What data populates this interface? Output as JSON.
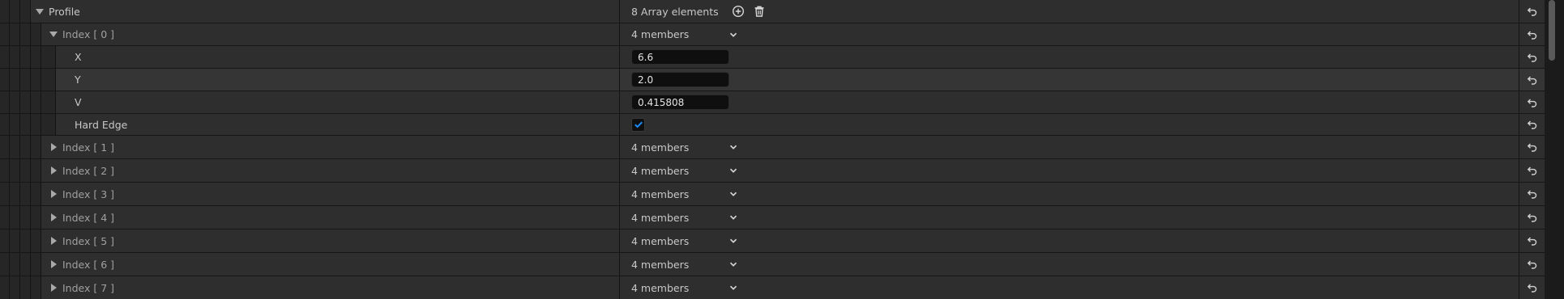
{
  "profile": {
    "label": "Profile",
    "array_count": "8 Array elements"
  },
  "index0": {
    "label": "Index [ 0 ]",
    "members": "4 members",
    "fields": {
      "x": {
        "label": "X",
        "value": "6.6"
      },
      "y": {
        "label": "Y",
        "value": "2.0"
      },
      "v": {
        "label": "V",
        "value": "0.415808"
      },
      "hard_edge": {
        "label": "Hard Edge",
        "checked": true
      }
    }
  },
  "collapsed": [
    {
      "label": "Index [ 1 ]",
      "members": "4 members"
    },
    {
      "label": "Index [ 2 ]",
      "members": "4 members"
    },
    {
      "label": "Index [ 3 ]",
      "members": "4 members"
    },
    {
      "label": "Index [ 4 ]",
      "members": "4 members"
    },
    {
      "label": "Index [ 5 ]",
      "members": "4 members"
    },
    {
      "label": "Index [ 6 ]",
      "members": "4 members"
    },
    {
      "label": "Index [ 7 ]",
      "members": "4 members"
    }
  ],
  "colors": {
    "accent": "#1a8cff",
    "row_bg": "#2e2e2e",
    "row_alt_bg": "#353535",
    "field_bg": "#0f0f0f"
  }
}
